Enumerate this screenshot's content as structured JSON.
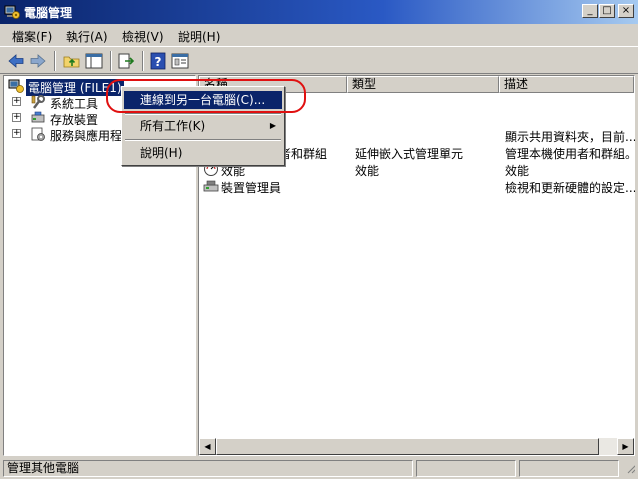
{
  "window": {
    "title": "電腦管理",
    "minimize": "_",
    "maximize": "□",
    "close": "×"
  },
  "menubar": [
    {
      "label": "檔案(F)"
    },
    {
      "label": "執行(A)"
    },
    {
      "label": "檢視(V)"
    },
    {
      "label": "說明(H)"
    }
  ],
  "toolbar": [
    "back-arrow-icon",
    "forward-arrow-icon",
    "up-folder-icon",
    "show-hide-tree-icon",
    "export-list-icon",
    "help-icon",
    "properties-icon"
  ],
  "tree": {
    "root": "電腦管理 (FILE1)",
    "items": [
      {
        "label": "系統工具",
        "expander": "+"
      },
      {
        "label": "存放裝置",
        "expander": "+"
      },
      {
        "label": "服務與應用程式",
        "expander": "+"
      }
    ]
  },
  "list": {
    "columns": [
      "名稱",
      "類型",
      "描述"
    ],
    "rows": [
      {
        "name": "",
        "type": "",
        "desc": "顯示共用資料夾，目前..."
      },
      {
        "name": "本機使用者和群組",
        "type": "延伸嵌入式管理單元",
        "desc": "管理本機使用者和群組。"
      },
      {
        "name": "效能",
        "type": "效能",
        "desc": "效能"
      },
      {
        "name": "裝置管理員",
        "type": "",
        "desc": "檢視和更新硬體的設定..."
      }
    ]
  },
  "context_menu": {
    "items": [
      {
        "label": "連線到另一台電腦(C)...",
        "selected": true
      },
      {
        "label": "所有工作(K)",
        "submenu": true
      },
      {
        "label": "說明(H)"
      }
    ]
  },
  "statusbar": {
    "text": "管理其他電腦"
  },
  "colors": {
    "title_start": "#0a246a",
    "selection": "#0a246a",
    "highlight_ring": "#e01010",
    "face": "#d4d0c8"
  }
}
